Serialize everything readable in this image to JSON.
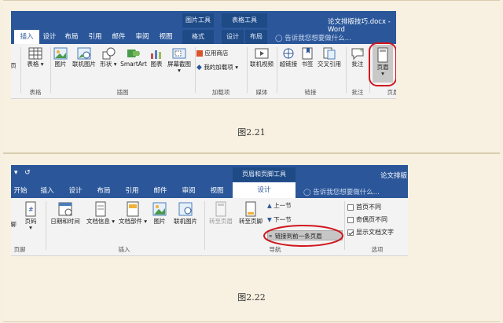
{
  "figure1": {
    "caption": "图2.21",
    "title": "论文排版技巧.docx - Word",
    "tabs": [
      "插入",
      "设计",
      "布局",
      "引用",
      "邮件",
      "审阅",
      "视图"
    ],
    "context_groups": [
      "图片工具",
      "表格工具"
    ],
    "context_tabs": [
      "格式",
      "设计",
      "布局"
    ],
    "search": "告诉我您想要做什么...",
    "buttons": {
      "page": "页",
      "table": "表格",
      "picture": "图片",
      "online_picture": "联机图片",
      "shapes": "形状",
      "smartart": "SmartArt",
      "chart": "图表",
      "screenshot": "屏幕截图",
      "store": "应用商店",
      "my_addins": "我的加载项",
      "online_video": "联机视频",
      "hyperlink": "超链接",
      "bookmark": "书签",
      "cross_ref": "交叉引用",
      "comment": "批注",
      "header": "页眉"
    },
    "groups": {
      "tables": "表格",
      "illustrations": "插图",
      "addins": "加载项",
      "media": "媒体",
      "links": "链接",
      "comments": "批注",
      "header_footer": "页眉"
    }
  },
  "figure2": {
    "caption": "图2.22",
    "title": "论文排版",
    "context_group": "页眉和页脚工具",
    "tabs": [
      "开始",
      "插入",
      "设计",
      "布局",
      "引用",
      "邮件",
      "审阅",
      "视图"
    ],
    "active_tab": "设计",
    "search": "告诉我您想要做什么...",
    "buttons": {
      "footer": "脚",
      "page_number": "页码",
      "datetime": "日期和时间",
      "doc_info": "文档信息",
      "quick_parts": "文档部件",
      "picture": "图片",
      "online_picture": "联机图片",
      "goto_header": "转至页眉",
      "goto_footer": "转至页脚",
      "prev": "上一节",
      "next": "下一节",
      "link_prev": "链接到前一条页眉"
    },
    "options": [
      "首页不同",
      "奇偶页不同",
      "显示文档文字"
    ],
    "groups": {
      "footer": "页脚",
      "insert": "插入",
      "nav": "导航",
      "options": "选项"
    }
  },
  "colors": {
    "word_blue": "#2b579a",
    "highlight_red": "#d0161e"
  }
}
